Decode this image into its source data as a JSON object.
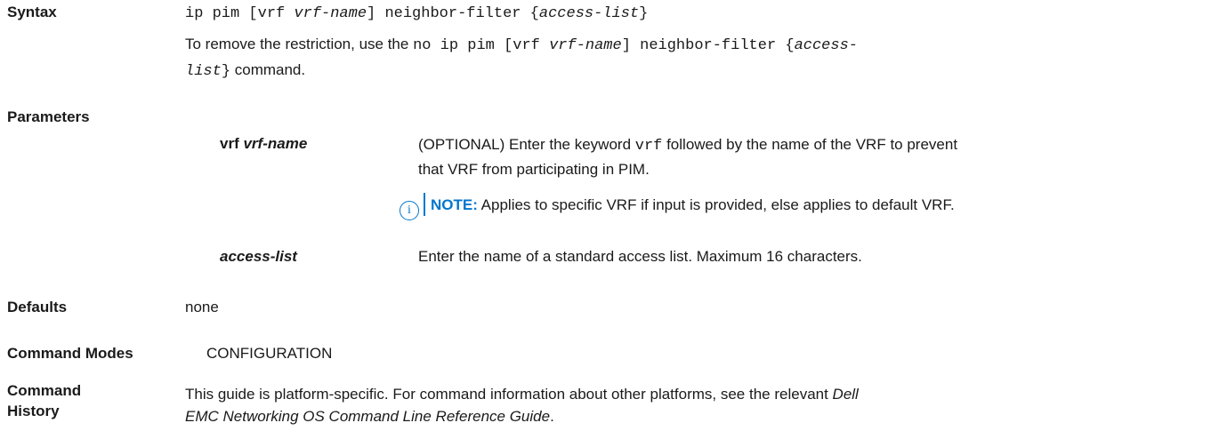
{
  "syntax": {
    "label": "Syntax",
    "cmd_p1": "ip pim [vrf ",
    "cmd_p2": "vrf-name",
    "cmd_p3": "] neighbor-filter {",
    "cmd_p4": "access-list",
    "cmd_p5": "}",
    "remove_text": "To remove the restriction, use the ",
    "no_p1": "no ip pim [vrf ",
    "no_p2": "vrf-name",
    "no_p3": "] neighbor-filter {",
    "no_p4": "access-",
    "no_p5": "list",
    "no_p6": "}",
    "command_word": " command."
  },
  "parameters": {
    "label": "Parameters",
    "items": [
      {
        "name_prefix": "vrf ",
        "name_var": "vrf-name",
        "desc_p1": "(OPTIONAL) Enter the keyword ",
        "desc_code": "vrf",
        "desc_p2": " followed by the name of the VRF to prevent",
        "desc_line2": "that VRF from participating in PIM.",
        "note_label": "NOTE:",
        "note_text": " Applies to specific VRF if input is provided, else applies to default VRF."
      },
      {
        "name_var": "access-list",
        "desc": "Enter the name of a standard access list. Maximum 16 characters."
      }
    ]
  },
  "defaults": {
    "label": "Defaults",
    "value": "none"
  },
  "command_modes": {
    "label": "Command Modes",
    "value": "CONFIGURATION"
  },
  "command_history": {
    "label_line1": "Command",
    "label_line2": "History",
    "text_p1": "This guide is platform-specific. For command information about other platforms, see the relevant ",
    "text_italic1": "Dell",
    "text_italic2": "EMC Networking OS Command Line Reference Guide",
    "text_end": "."
  },
  "note_icon_glyph": "i",
  "colors": {
    "note_accent": "#0076ce",
    "text": "#1a1a1a"
  }
}
